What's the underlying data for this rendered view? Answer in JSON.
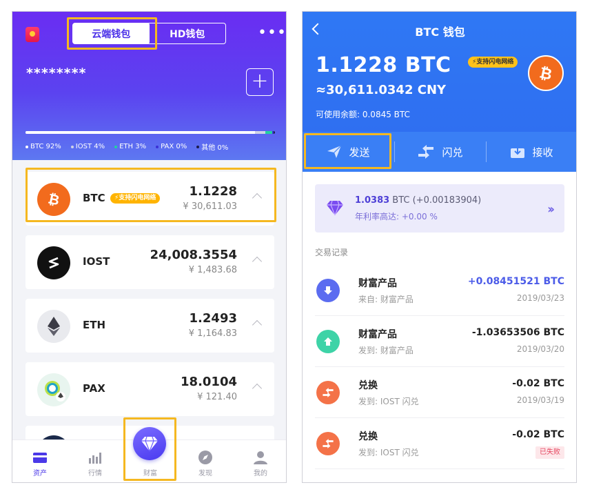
{
  "left": {
    "segment": {
      "cloud_wallet": "云端钱包",
      "hd_wallet": "HD钱包"
    },
    "masked_balance": "********",
    "allocation": [
      {
        "label": "BTC 92%",
        "percent": 92,
        "color": "#ffffff"
      },
      {
        "label": "IOST 4%",
        "percent": 4,
        "color": "#cfd2e6"
      },
      {
        "label": "ETH 3%",
        "percent": 3,
        "color": "#22d3a0"
      },
      {
        "label": "PAX 0%",
        "percent": 0.5,
        "color": "#3b2fd6"
      },
      {
        "label": "其他 0%",
        "percent": 0.5,
        "color": "#1b1b4a"
      }
    ],
    "coins": [
      {
        "name": "BTC",
        "amount": "1.1228",
        "cny": "¥ 30,611.03",
        "badge": "支持闪电网络"
      },
      {
        "name": "IOST",
        "amount": "24,008.3554",
        "cny": "¥ 1,483.68"
      },
      {
        "name": "ETH",
        "amount": "1.2493",
        "cny": "¥ 1,164.83"
      },
      {
        "name": "PAX",
        "amount": "18.0104",
        "cny": "¥ 121.40"
      }
    ],
    "tabs": [
      {
        "label": "资产"
      },
      {
        "label": "行情"
      },
      {
        "label": "财富"
      },
      {
        "label": "发现"
      },
      {
        "label": "我的"
      }
    ],
    "colors": {
      "accent": "#4b39e8",
      "highlight": "#f5b820",
      "btc": "#f26b1d"
    }
  },
  "right": {
    "title": "BTC 钱包",
    "balance": "1.1228 BTC",
    "badge": "支持闪电网络",
    "cny_balance": "≈30,611.0342 CNY",
    "available": "可使用余额: 0.0845 BTC",
    "actions": {
      "send": "发送",
      "swap": "闪兑",
      "receive": "接收"
    },
    "wealth": {
      "amount": "1.0383",
      "unit_change": " BTC (+0.00183904)",
      "rate": "年利率高达: +0.00 %"
    },
    "records_title": "交易记录",
    "transactions": [
      {
        "name": "财富产品",
        "sub": "来自: 财富产品",
        "amount": "+0.08451521 BTC",
        "date": "2019/03/23"
      },
      {
        "name": "财富产品",
        "sub": "发到: 财富产品",
        "amount": "-1.03653506 BTC",
        "date": "2019/03/20"
      },
      {
        "name": "兑换",
        "sub": "发到: IOST 闪兑",
        "amount": "-0.02 BTC",
        "date": "2019/03/19"
      },
      {
        "name": "兑换",
        "sub": "发到: IOST 闪兑",
        "amount": "-0.02 BTC",
        "status": "已失败"
      }
    ]
  }
}
